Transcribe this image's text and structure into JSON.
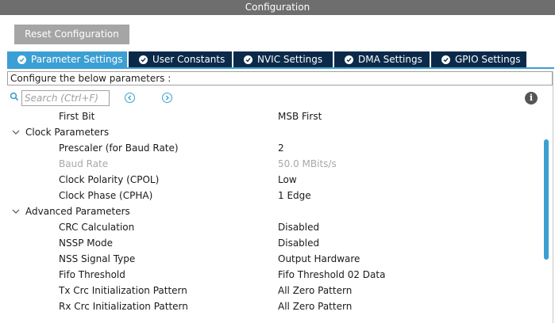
{
  "window": {
    "title": "Configuration"
  },
  "toolbar": {
    "reset_label": "Reset Configuration"
  },
  "tabs": [
    {
      "label": "Parameter Settings",
      "active": true
    },
    {
      "label": "User Constants",
      "active": false
    },
    {
      "label": "NVIC Settings",
      "active": false
    },
    {
      "label": "DMA Settings",
      "active": false
    },
    {
      "label": "GPIO Settings",
      "active": false
    }
  ],
  "description": "Configure the below parameters :",
  "search": {
    "placeholder": "Search (Ctrl+F)"
  },
  "params": {
    "first_bit": {
      "label": "First Bit",
      "value": "MSB First"
    },
    "clock_group": "Clock Parameters",
    "prescaler": {
      "label": "Prescaler (for Baud Rate)",
      "value": "2"
    },
    "baud_rate": {
      "label": "Baud Rate",
      "value": "50.0 MBits/s"
    },
    "cpol": {
      "label": "Clock Polarity (CPOL)",
      "value": "Low"
    },
    "cpha": {
      "label": "Clock Phase (CPHA)",
      "value": "1 Edge"
    },
    "advanced_group": "Advanced Parameters",
    "crc": {
      "label": "CRC Calculation",
      "value": "Disabled"
    },
    "nssp": {
      "label": "NSSP Mode",
      "value": "Disabled"
    },
    "nss": {
      "label": "NSS Signal Type",
      "value": "Output Hardware"
    },
    "fifo": {
      "label": "Fifo Threshold",
      "value": "Fifo Threshold 02 Data"
    },
    "tx_crc": {
      "label": "Tx Crc Initialization Pattern",
      "value": "All Zero Pattern"
    },
    "rx_crc": {
      "label": "Rx Crc Initialization Pattern",
      "value": "All Zero Pattern"
    }
  },
  "colors": {
    "accent": "#3c9fd4",
    "tab_dark": "#0b2a4a",
    "titlebar": "#6e6e6e"
  }
}
